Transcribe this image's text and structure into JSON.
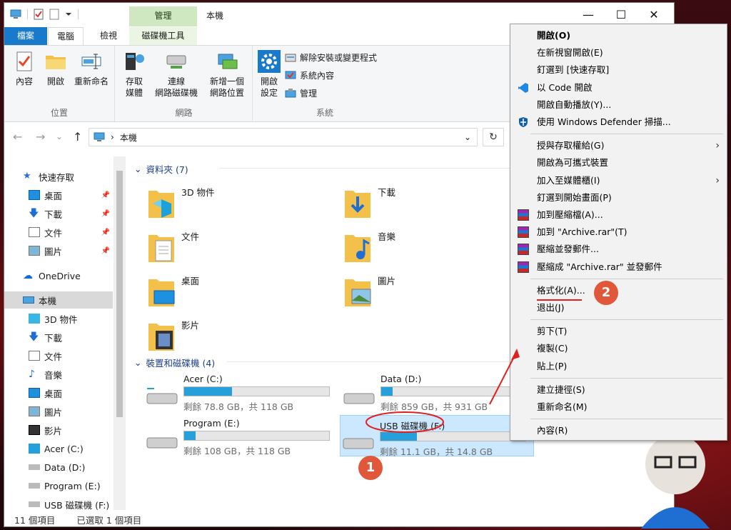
{
  "window": {
    "title": "本機",
    "context_tab_group": "管理",
    "controls": {
      "minimize": "—",
      "maximize": "☐",
      "close": "✕"
    }
  },
  "ribbon_tabs": [
    "檔案",
    "電腦",
    "檢視",
    "磁碟機工具"
  ],
  "ribbon": {
    "groups": [
      {
        "label": "位置",
        "buttons": [
          {
            "label": "內容",
            "icon": "properties-check-icon"
          },
          {
            "label": "開啟",
            "icon": "open-folder-icon"
          },
          {
            "label": "重新命名",
            "icon": "rename-icon"
          }
        ]
      },
      {
        "label": "網路",
        "buttons": [
          {
            "label": "存取\n媒體",
            "icon": "media-access-icon",
            "has_dropdown": true
          },
          {
            "label": "連線\n網路磁碟機",
            "icon": "network-drive-icon",
            "has_dropdown": true
          },
          {
            "label": "新增一個\n網路位置",
            "icon": "network-location-icon"
          }
        ]
      },
      {
        "label": "系統",
        "buttons": [
          {
            "label": "開啟\n設定",
            "icon": "gear-icon"
          }
        ],
        "small_buttons": [
          {
            "label": "解除安裝或變更程式",
            "icon": "uninstall-icon"
          },
          {
            "label": "系統內容",
            "icon": "system-properties-icon"
          },
          {
            "label": "管理",
            "icon": "manage-icon"
          }
        ]
      }
    ]
  },
  "address": {
    "back": "←",
    "forward": "→",
    "recent": "⌄",
    "up": "↑",
    "path": "本機",
    "chevron": "›",
    "dropdown": "⌄",
    "refresh": "↻"
  },
  "navpane": {
    "items": [
      {
        "label": "快速存取",
        "icon": "star-icon",
        "pinned": false
      },
      {
        "label": "桌面",
        "icon": "desktop-icon",
        "pinned": true
      },
      {
        "label": "下載",
        "icon": "download-icon",
        "pinned": true
      },
      {
        "label": "文件",
        "icon": "documents-icon",
        "pinned": true
      },
      {
        "label": "圖片",
        "icon": "pictures-icon",
        "pinned": true
      },
      {
        "label": "OneDrive",
        "icon": "cloud-icon",
        "pinned": false
      },
      {
        "label": "本機",
        "icon": "computer-icon",
        "pinned": false,
        "selected": true
      },
      {
        "label": "3D 物件",
        "icon": "cube-icon",
        "pinned": false
      },
      {
        "label": "下載",
        "icon": "download-icon",
        "pinned": false
      },
      {
        "label": "文件",
        "icon": "documents-icon",
        "pinned": false
      },
      {
        "label": "音樂",
        "icon": "music-icon",
        "pinned": false
      },
      {
        "label": "桌面",
        "icon": "desktop-icon",
        "pinned": false
      },
      {
        "label": "圖片",
        "icon": "pictures-icon",
        "pinned": false
      },
      {
        "label": "影片",
        "icon": "video-icon",
        "pinned": false
      },
      {
        "label": "Acer (C:)",
        "icon": "windows-drive-icon",
        "pinned": false
      },
      {
        "label": "Data (D:)",
        "icon": "drive-icon",
        "pinned": false
      },
      {
        "label": "Program (E:)",
        "icon": "drive-icon",
        "pinned": false
      },
      {
        "label": "USB 磁碟機 (F:)",
        "icon": "drive-icon",
        "pinned": false
      }
    ],
    "pin_glyph": "📌"
  },
  "content": {
    "folders_header": "資料夾 (7)",
    "folders": [
      {
        "name": "3D 物件",
        "icon": "cube-folder-icon"
      },
      {
        "name": "下載",
        "icon": "download-folder-icon"
      },
      {
        "name": "文件",
        "icon": "documents-folder-icon"
      },
      {
        "name": "音樂",
        "icon": "music-folder-icon"
      },
      {
        "name": "桌面",
        "icon": "desktop-folder-icon"
      },
      {
        "name": "圖片",
        "icon": "pictures-folder-icon"
      },
      {
        "name": "影片",
        "icon": "video-folder-icon"
      }
    ],
    "drives_header": "裝置和磁碟機 (4)",
    "drives": [
      {
        "name": "Acer (C:)",
        "free": "剩餘 78.8 GB，共 118 GB",
        "used_fraction": 0.33,
        "icon": "windows-drive-icon"
      },
      {
        "name": "Data (D:)",
        "free": "剩餘 859 GB，共 931 GB",
        "used_fraction": 0.08,
        "icon": "drive-icon"
      },
      {
        "name": "Program (E:)",
        "free": "剩餘 108 GB，共 118 GB",
        "used_fraction": 0.08,
        "icon": "drive-icon"
      },
      {
        "name": "USB 磁碟機 (F:)",
        "free": "剩餘 11.1 GB，共 14.8 GB",
        "used_fraction": 0.25,
        "icon": "usb-drive-icon",
        "selected": true
      }
    ]
  },
  "status": {
    "items": "11 個項目",
    "selected": "已選取 1 個項目"
  },
  "context_menu": {
    "items": [
      {
        "label": "開啟(O)",
        "bold": true
      },
      {
        "label": "在新視窗開啟(E)"
      },
      {
        "label": "釘選到 [快速存取]"
      },
      {
        "label": "以 Code 開啟",
        "icon": "vscode-icon"
      },
      {
        "label": "開啟自動播放(Y)..."
      },
      {
        "label": "使用 Windows Defender 掃描...",
        "icon": "defender-shield-icon"
      },
      {
        "separator": true
      },
      {
        "label": "授與存取權給(G)",
        "submenu": true
      },
      {
        "label": "開啟為可攜式裝置"
      },
      {
        "label": "加入至媒體櫃(I)",
        "submenu": true
      },
      {
        "label": "釘選到開始畫面(P)"
      },
      {
        "label": "加到壓縮檔(A)...",
        "icon": "winrar-icon"
      },
      {
        "label": "加到 \"Archive.rar\"(T)",
        "icon": "winrar-icon"
      },
      {
        "label": "壓縮並發郵件...",
        "icon": "winrar-icon"
      },
      {
        "label": "壓縮成 \"Archive.rar\" 並發郵件",
        "icon": "winrar-icon"
      },
      {
        "separator": true
      },
      {
        "label": "格式化(A)...",
        "highlighted_annotation": true
      },
      {
        "label": "退出(J)"
      },
      {
        "separator": true
      },
      {
        "label": "剪下(T)"
      },
      {
        "label": "複製(C)"
      },
      {
        "label": "貼上(P)"
      },
      {
        "separator": true
      },
      {
        "label": "建立捷徑(S)"
      },
      {
        "label": "重新命名(M)"
      },
      {
        "separator": true
      },
      {
        "label": "內容(R)"
      }
    ],
    "submenu_arrow": "›"
  },
  "annotations": {
    "badge1": "1",
    "badge2": "2",
    "color": "#e0573a",
    "ink": "#e02020"
  }
}
